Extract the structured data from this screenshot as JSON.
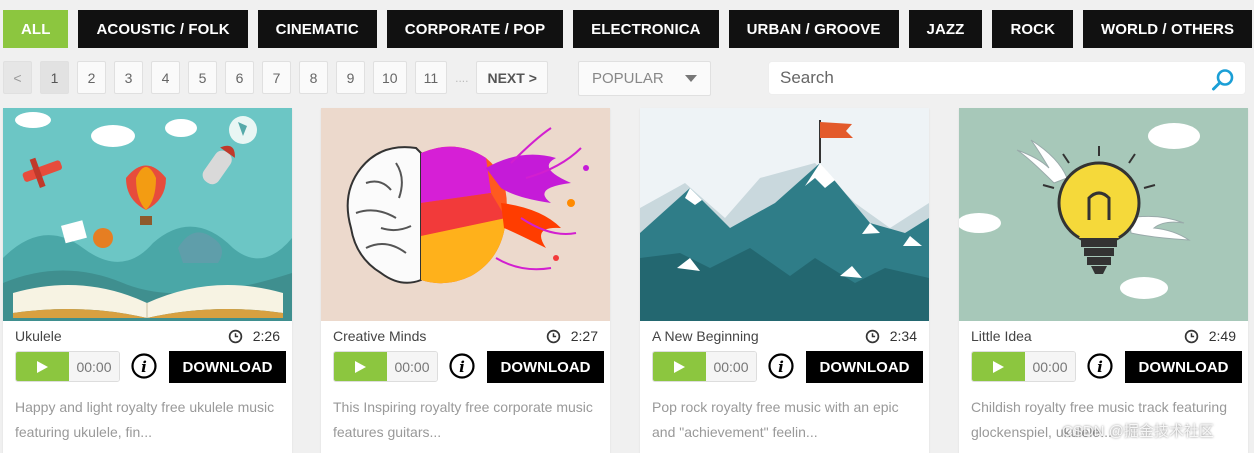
{
  "genres": [
    {
      "label": "ALL",
      "active": true
    },
    {
      "label": "ACOUSTIC / FOLK"
    },
    {
      "label": "CINEMATIC"
    },
    {
      "label": "CORPORATE / POP"
    },
    {
      "label": "ELECTRONICA"
    },
    {
      "label": "URBAN / GROOVE"
    },
    {
      "label": "JAZZ"
    },
    {
      "label": "ROCK"
    },
    {
      "label": "WORLD / OTHERS"
    }
  ],
  "pagination": {
    "prev": "<",
    "pages": [
      "1",
      "2",
      "3",
      "4",
      "5",
      "6",
      "7",
      "8",
      "9",
      "10",
      "11"
    ],
    "current": "1",
    "ellipsis": "....",
    "next": "NEXT >"
  },
  "sort": {
    "value": "POPULAR"
  },
  "search": {
    "placeholder": "Search"
  },
  "tracks": [
    {
      "title": "Ukulele",
      "duration": "2:26",
      "time": "00:00",
      "download": "DOWNLOAD",
      "desc": "Happy and light royalty free ukulele music featuring ukulele, fin..."
    },
    {
      "title": "Creative Minds",
      "duration": "2:27",
      "time": "00:00",
      "download": "DOWNLOAD",
      "desc": "This Inspiring royalty free corporate music features guitars..."
    },
    {
      "title": "A New Beginning",
      "duration": "2:34",
      "time": "00:00",
      "download": "DOWNLOAD",
      "desc": "Pop rock royalty free music with an epic and \"achievement\" feelin..."
    },
    {
      "title": "Little Idea",
      "duration": "2:49",
      "time": "00:00",
      "download": "DOWNLOAD",
      "desc": "Childish royalty free music track featuring glockenspiel, ukulele..."
    }
  ],
  "watermark": "CSDN @掘金技术社区"
}
